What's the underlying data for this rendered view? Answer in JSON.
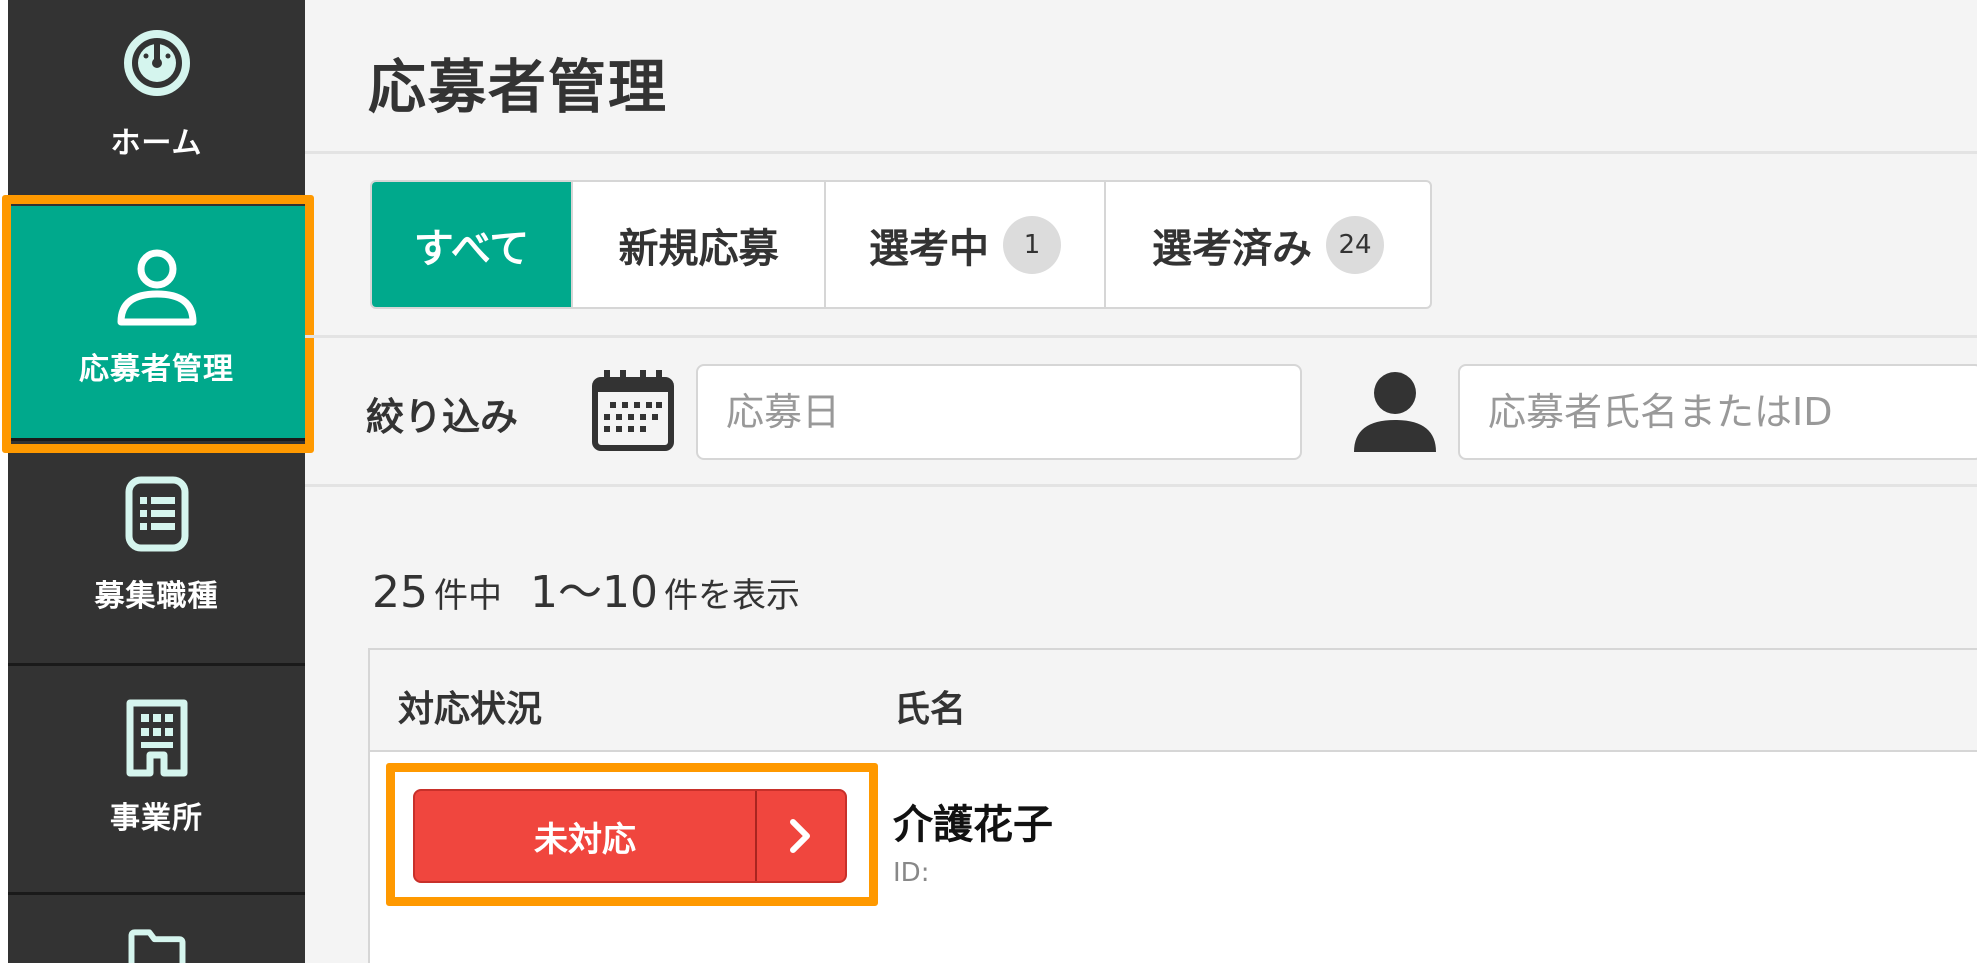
{
  "sidebar": {
    "items": [
      {
        "label": "ホーム",
        "icon": "dashboard-gauge-icon"
      },
      {
        "label": "応募者管理",
        "icon": "user-icon",
        "active": true
      },
      {
        "label": "募集職種",
        "icon": "list-icon"
      },
      {
        "label": "事業所",
        "icon": "building-icon"
      },
      {
        "label": "",
        "icon": "folder-icon"
      }
    ]
  },
  "page": {
    "title": "応募者管理"
  },
  "tabs": [
    {
      "label": "すべて",
      "active": true
    },
    {
      "label": "新規応募"
    },
    {
      "label": "選考中",
      "badge": "1"
    },
    {
      "label": "選考済み",
      "badge": "24"
    }
  ],
  "filter": {
    "label": "絞り込み",
    "date_placeholder": "応募日",
    "name_placeholder": "応募者氏名またはID"
  },
  "results": {
    "total": "25",
    "total_unit": "件中",
    "range": "1〜10",
    "range_unit": "件を表示"
  },
  "table": {
    "headers": {
      "status": "対応状況",
      "name": "氏名"
    },
    "rows": [
      {
        "status": "未対応",
        "name": "介護花子",
        "id_label": "ID:"
      }
    ]
  },
  "colors": {
    "accent": "#00a98c",
    "sidebar_bg": "#333333",
    "status_unhandled": "#f0463e",
    "highlight": "#ff9900"
  }
}
